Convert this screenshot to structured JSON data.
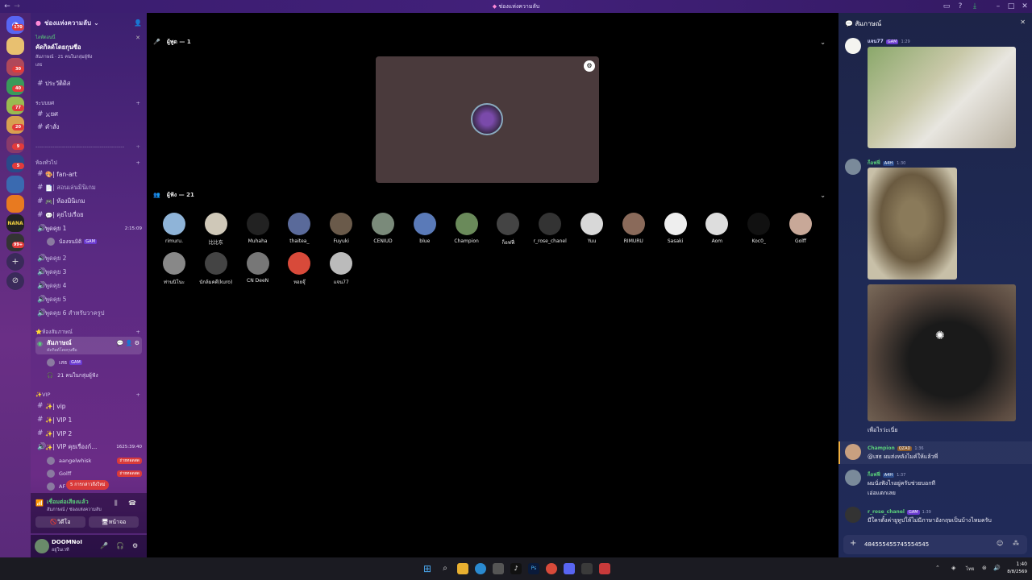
{
  "window": {
    "title": "ช่องแห่งความลับ"
  },
  "rail": {
    "badges": [
      "170",
      "30",
      "40",
      "77",
      "20",
      "9",
      "5",
      "99+"
    ],
    "nana_label": "NANA"
  },
  "sidebar": {
    "server_name": "ช่องแห่งความลับ",
    "event": {
      "status": "ไลฟ์ตอนนี้",
      "title": "คัดกิลด์โดยกุนซือ",
      "detail": "สัมภาษณ์ · 21 คนในกลุ่มผู้ฟัง",
      "host": "เสธ"
    },
    "channel_top": "ประวัติดิส",
    "category_rank": "ระบบยศ",
    "rank_channels": [
      "ยศ",
      "คำสั่ง"
    ],
    "divider_label": "----------------------------------------------------------",
    "category_general": "ห้องทั่วไป",
    "general_channels": [
      "| fan-art",
      "| สอนเล่นมินิเกม",
      "| ห้องมินิเกม",
      "| คุยไปเรื่อย"
    ],
    "voice_talk1": {
      "name": "พูดคุย 1",
      "time": "2:15:09",
      "user": "น้องจนมิติ",
      "user_tag": "GAM"
    },
    "voice_channels": [
      "พูดคุย 2",
      "พูดคุย 3",
      "พูดคุย 4",
      "พูดคุย 5",
      "พูดคุย 6 สำหรับวาครูป"
    ],
    "category_interview": "ห้องสัมภาษณ์",
    "interview": {
      "name": "สัมภาษณ์",
      "sub": "คัดกิลด์โดยกุนซือ",
      "speaker": "เสธ",
      "speaker_tag": "GAM",
      "audience": "21 คนในกลุ่มผู้ฟัง"
    },
    "category_vip": "VIP",
    "vip_channels": [
      "| vip",
      "| VIP 1",
      "| VIP 2"
    ],
    "vip_talk": {
      "name": "| VIP คุยเรื่องก์...",
      "time": "1625:39:40"
    },
    "vip_users": [
      {
        "name": "aangelwhisk",
        "badge": "ถ่ายทอดสด"
      },
      {
        "name": "Golff",
        "badge": "ถ่ายทอดสด"
      },
      {
        "name": "AF",
        "badge": ""
      }
    ],
    "new_mentions": "5 การกล่าวถึงใหม่",
    "voice_connected": {
      "title": "เชื่อมต่อเสียงแล้ว",
      "sub": "สัมภาษณ์ / ช่องแห่งความลับ",
      "video_btn": "วิดีโอ",
      "screen_btn": "หน้าจอ"
    },
    "user": {
      "name": "DOOMNoI",
      "status": "อยู่ในเวที"
    }
  },
  "stage": {
    "speakers_header": "ผู้พูด — 1",
    "audience_header": "ผู้ฟัง — 21",
    "audience": [
      "rimuru.",
      "比比东",
      "Muhaha",
      "thaitea_",
      "Fuyuki",
      "CENIUD",
      "blue",
      "Champion",
      "ก็อฟฟี่",
      "r_rose_chanel",
      "Yuu",
      "RIMURU",
      "Sasaki",
      "Aom",
      "Koc0_",
      "Golff",
      "ท่านนิโนะ",
      "นักล้มคดี(kuro)",
      "CN DeeN",
      "หอยจุ๊",
      "แจน77"
    ],
    "audience_colors": [
      "#8fb4d8",
      "#cfc8b8",
      "#222222",
      "#5a6a9a",
      "#6a5a4a",
      "#7a8a7a",
      "#5a7ab8",
      "#6a8a5a",
      "#444444",
      "#333333",
      "#d8d8d8",
      "#8a6a5a",
      "#eeeeee",
      "#dddddd",
      "#111111",
      "#c8a898",
      "#888888",
      "#444444",
      "#777777",
      "#d84a3a",
      "#bbbbbb"
    ]
  },
  "chat": {
    "title": "สัมภาษณ์",
    "messages": [
      {
        "name": "แจน77",
        "tag": "GAM",
        "time": "1:29",
        "text": "",
        "color": "#cfd3ff"
      },
      {
        "name": "ก็อฟฟี่",
        "tag": "A4H",
        "time": "1:30",
        "text": "",
        "color": "#5ad07a"
      },
      {
        "name": "",
        "tag": "",
        "time": "",
        "text": "เพื่อไรว่ะเนี่ย",
        "color": "#ffffff"
      },
      {
        "name": "Champion",
        "tag": "QZAD",
        "time": "1:36",
        "text": "@เสธ ผมส่งหลังไมค์ให้แล้วพี่",
        "color": "#5ad07a"
      },
      {
        "name": "ก็อฟฟี่",
        "tag": "A4H",
        "time": "1:37",
        "text": "ผมนั่งฟังไรอยู่ครับช่วยบอกที",
        "text2": "เอ่อแตกเลย",
        "color": "#5ad07a"
      },
      {
        "name": "r_rose_chanel",
        "tag": "GAM",
        "time": "1:39",
        "text": "มีใครตั้งค่ายูทูปให้ไม่มีภาษาอังกฤษเป็นบ้างไหมครับ",
        "color": "#5ad07a"
      }
    ],
    "input_value": "484555455745554545"
  },
  "taskbar": {
    "lang": "ไทย",
    "time": "1:40",
    "date": "8/8/2569"
  }
}
